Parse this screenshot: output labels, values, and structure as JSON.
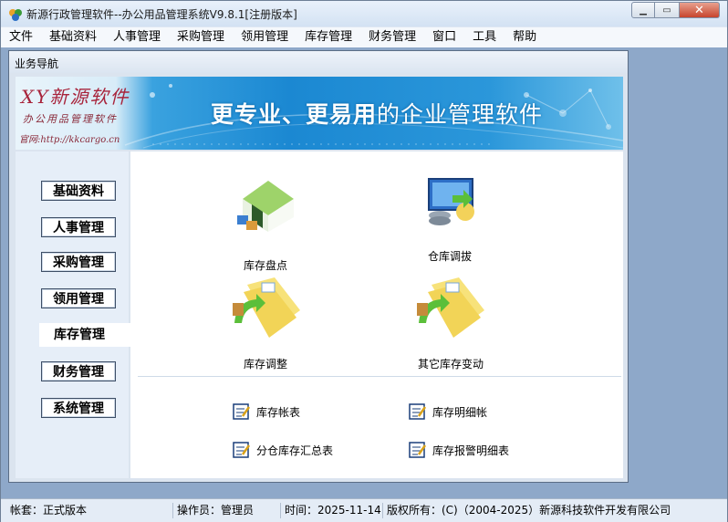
{
  "window": {
    "title": "新源行政管理软件--办公用品管理系统V9.8.1[注册版本]",
    "close_glyph": "✕",
    "max_glyph": "▭",
    "min_glyph": "▁"
  },
  "menubar": {
    "items": [
      "文件",
      "基础资料",
      "人事管理",
      "采购管理",
      "领用管理",
      "库存管理",
      "财务管理",
      "窗口",
      "工具",
      "帮助"
    ]
  },
  "child": {
    "title": "业务导航"
  },
  "banner": {
    "brand_logo": "XY新源软件",
    "brand_sub": "办公用品管理软件",
    "brand_url": "官网:http://kkcargo.cn",
    "slogan_a": "更专业、更易用",
    "slogan_b": "的企业管理软件"
  },
  "nav": {
    "items": [
      "基础资料",
      "人事管理",
      "采购管理",
      "领用管理",
      "库存管理",
      "财务管理",
      "系统管理"
    ],
    "active_index": 4
  },
  "tiles": [
    {
      "label": "库存盘点",
      "icon": "warehouse-icon"
    },
    {
      "label": "仓库调拔",
      "icon": "transfer-icon"
    },
    {
      "label": "库存调整",
      "icon": "folder-adjust-icon"
    },
    {
      "label": "其它库存变动",
      "icon": "folder-other-icon"
    }
  ],
  "reports": [
    {
      "label": "库存帐表"
    },
    {
      "label": "库存明细帐"
    },
    {
      "label": "分仓库存汇总表"
    },
    {
      "label": "库存报警明细表"
    }
  ],
  "status": {
    "account": "帐套：正式版本",
    "operator": "操作员：管理员",
    "time": "时间：2025-11-14",
    "copyright": "版权所有：(C)（2004-2025）新源科技软件开发有限公司"
  },
  "colors": {
    "accent": "#1b88d2",
    "brand": "#a8243c"
  }
}
